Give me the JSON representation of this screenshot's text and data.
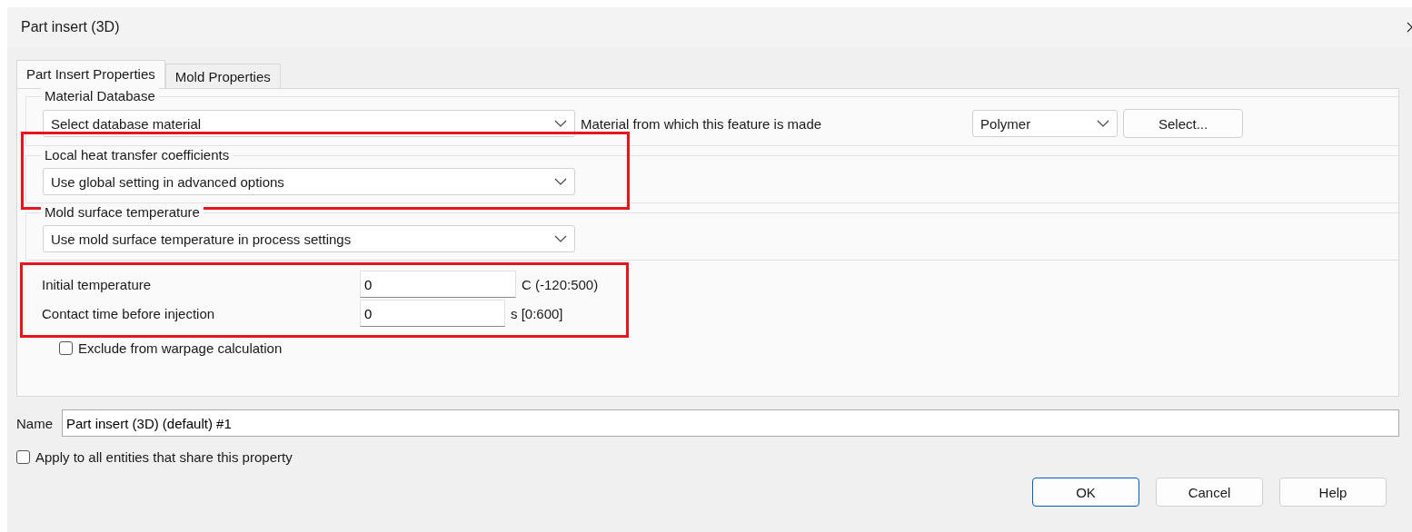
{
  "window": {
    "title": "Part insert (3D)"
  },
  "tabs": [
    {
      "label": "Part Insert Properties",
      "selected": true
    },
    {
      "label": "Mold Properties",
      "selected": false
    }
  ],
  "sections": [
    {
      "legend": "Material Database",
      "dropdown": "Select database material",
      "note": "Material from which this feature is made",
      "type_dropdown": "Polymer",
      "button": "Select...",
      "highlighted": false
    },
    {
      "legend": "Local heat transfer coefficients",
      "dropdown": "Use global setting in advanced options",
      "highlighted": true
    },
    {
      "legend": "Mold surface temperature",
      "dropdown": "Use mold surface temperature in process settings",
      "highlighted": false
    }
  ],
  "fields_highlighted": true,
  "fields": [
    {
      "label": "Initial temperature",
      "value": "0",
      "range": "C (-120:500)"
    },
    {
      "label": "Contact time before injection",
      "value": "0",
      "range": "s [0:600]"
    }
  ],
  "exclude_warpage": {
    "label": "Exclude from warpage calculation",
    "checked": false
  },
  "name": {
    "label": "Name",
    "value": "Part insert (3D) (default) #1"
  },
  "apply_all": {
    "label": "Apply to all entities that share this property",
    "checked": false
  },
  "buttons": [
    "OK",
    "Cancel",
    "Help"
  ]
}
